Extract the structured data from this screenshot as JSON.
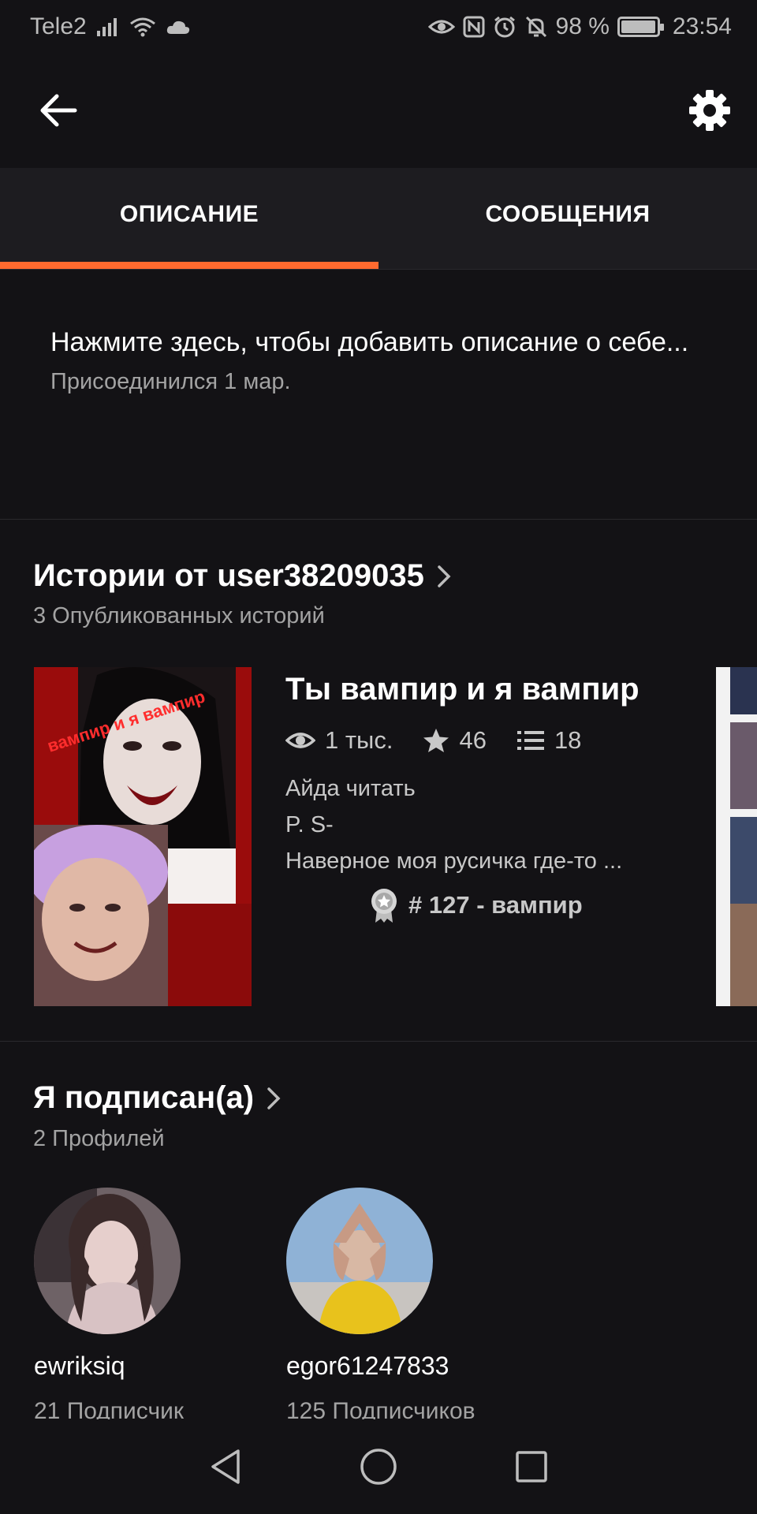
{
  "status_bar": {
    "carrier": "Tele2",
    "battery": "98 %",
    "battery_level": 0.98,
    "time": "23:54",
    "icons": [
      "signal-icon",
      "wifi-icon",
      "cloud-icon",
      "eye-icon",
      "nfc-icon",
      "alarm-icon",
      "mute-icon",
      "battery-icon"
    ]
  },
  "top_bar": {
    "back_icon": "arrow-left-icon",
    "settings_icon": "gear-icon"
  },
  "tabs": [
    {
      "label": "ОПИСАНИЕ",
      "active": true
    },
    {
      "label": "СООБЩЕНИЯ",
      "active": false
    }
  ],
  "description": {
    "prompt": "Нажмите здесь, чтобы добавить описание о себе...",
    "joined": "Присоединился 1 мар."
  },
  "stories": {
    "title": "Истории от user38209035",
    "subtitle": "3 Опубликованных историй",
    "items": [
      {
        "title": "Ты вампир и я вампир",
        "cover_text": "вампир и я вампир",
        "reads": "1 тыс.",
        "votes": "46",
        "parts": "18",
        "description_lines": [
          "Айда читать",
          "P. S-",
          "Наверное моя русичка где-то ..."
        ],
        "rank": "# 127 - вампир"
      }
    ]
  },
  "following": {
    "title": "Я подписан(а)",
    "subtitle": "2 Профилей",
    "profiles": [
      {
        "name": "ewriksiq",
        "followers": "21 Подписчик"
      },
      {
        "name": "egor61247833",
        "followers": "125 Подписчиков"
      }
    ]
  },
  "colors": {
    "background": "#131215",
    "tab_bar": "#1d1c20",
    "accent": "#ff6a2f",
    "secondary_text": "#a3a3a3"
  }
}
